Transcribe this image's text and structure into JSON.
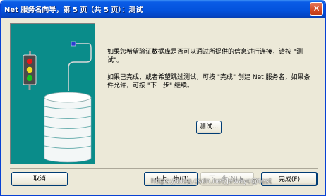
{
  "window": {
    "title": "Net 服务名向导，第 5 页（共 5 页）：测试",
    "close_glyph": "✕"
  },
  "colors": {
    "title_bar": "#0453dd",
    "dialog_bg": "#ece9d8",
    "illustration_bg": "#0a8c8a"
  },
  "illustration": {
    "icons": [
      "traffic-light-icon",
      "database-icon",
      "network-plug-icon"
    ]
  },
  "content": {
    "paragraph_1": "如果您希望验证数据库是否可以通过所提供的信息进行连接，请按 \"测试\"。",
    "paragraph_2": "如果已完成，或者希望跳过测试，可按 \"完成\" 创建 Net 服务名，如果条件允许，可按 \"下一步\" 继续。",
    "test_button": "测试..."
  },
  "footer": {
    "cancel": "取消",
    "back": "上一步(B)",
    "next": "下一步(N)",
    "finish": "完成(F)"
  },
  "watermark": "https://blog.csdn.net/Jewayc@test"
}
